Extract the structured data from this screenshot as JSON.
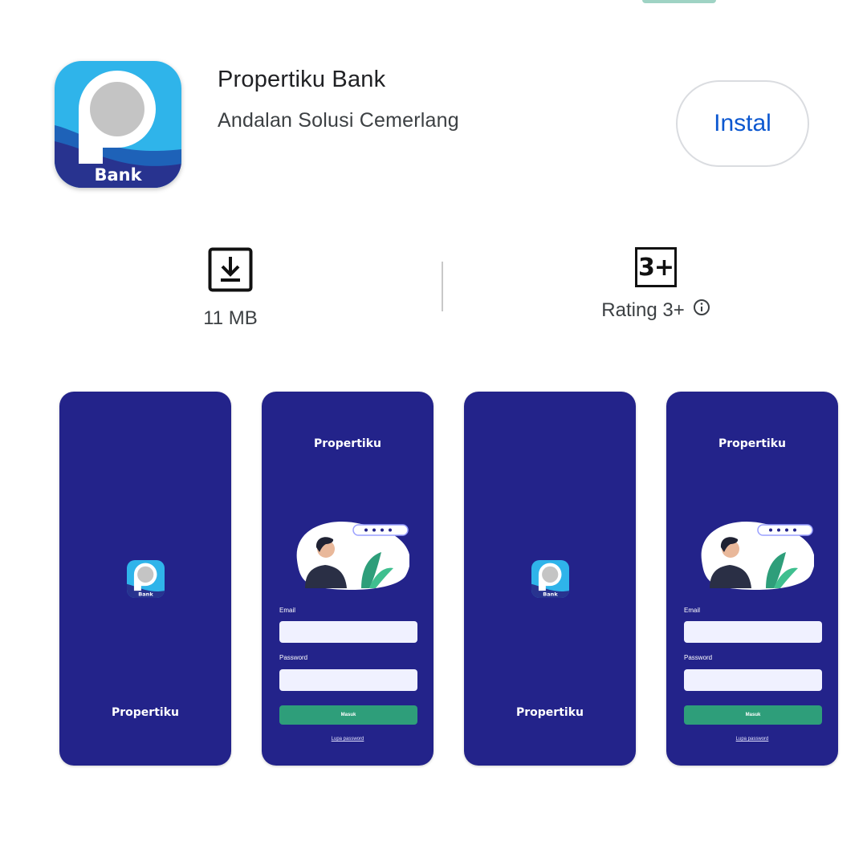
{
  "app": {
    "name": "Propertiku Bank",
    "developer": "Andalan Solusi Cemerlang",
    "icon_label": "Bank",
    "install_label": "Instal"
  },
  "stats": {
    "size": "11 MB",
    "rating_badge": "3+",
    "rating_label": "Rating 3+",
    "size_icon": "download-icon",
    "info_icon": "info-icon"
  },
  "screenshots": [
    {
      "type": "splash",
      "title": "Propertiku",
      "icon_label": "Bank"
    },
    {
      "type": "login",
      "title": "Propertiku",
      "email_label": "Email",
      "password_label": "Password",
      "button_label": "Masuk",
      "forgot_label": "Lupa password"
    },
    {
      "type": "splash",
      "title": "Propertiku",
      "icon_label": "Bank"
    },
    {
      "type": "login",
      "title": "Propertiku",
      "email_label": "Email",
      "password_label": "Password",
      "button_label": "Masuk",
      "forgot_label": "Lupa password"
    }
  ],
  "colors": {
    "accent": "#0b57d0",
    "icon_blue": "#2fb4ea",
    "screenshot_bg": "#23238a",
    "login_button": "#2e9e7a"
  }
}
